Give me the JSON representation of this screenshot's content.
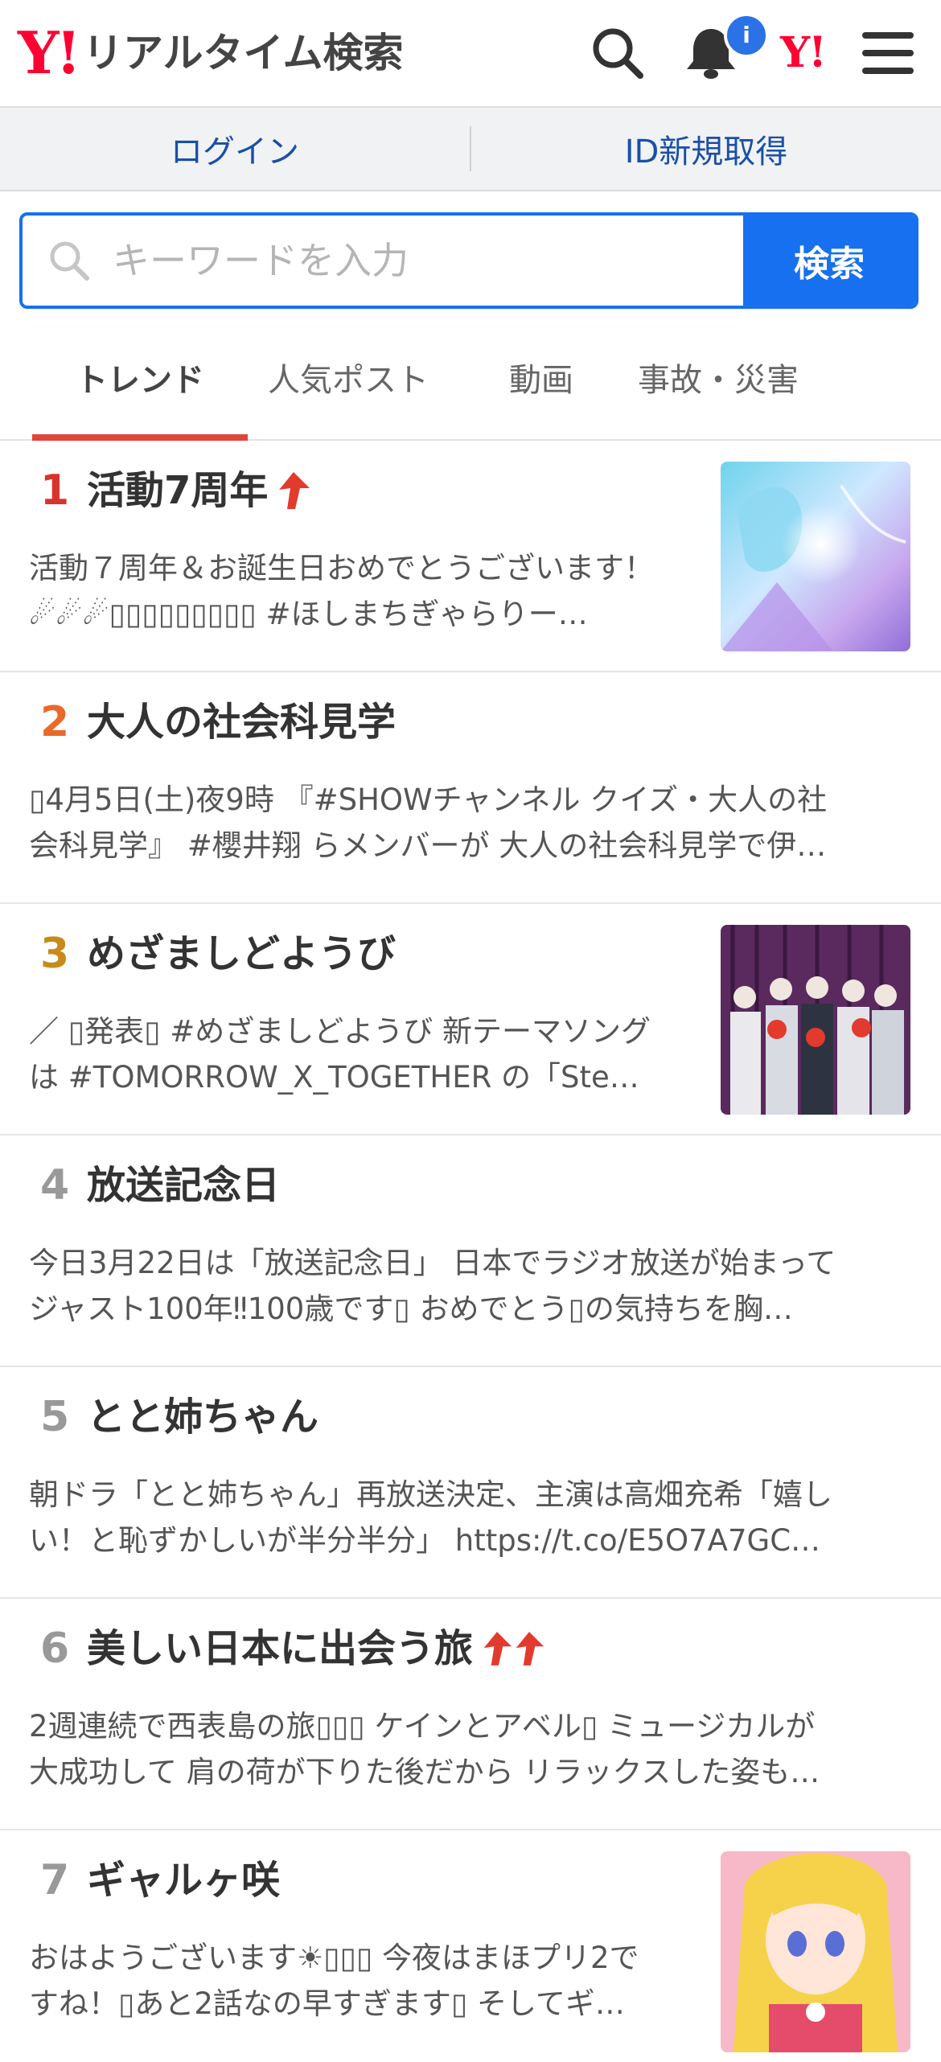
{
  "header": {
    "logo_mark": "Y!",
    "site_name": "リアルタイム検索",
    "notification_badge": "i",
    "yj_icon_text": "Y!"
  },
  "auth": {
    "login": "ログイン",
    "register": "ID新規取得"
  },
  "search": {
    "placeholder": "キーワードを入力",
    "button": "検索"
  },
  "tabs": [
    {
      "label": "トレンド",
      "active": true
    },
    {
      "label": "人気ポスト",
      "active": false
    },
    {
      "label": "動画",
      "active": false
    },
    {
      "label": "事故・災害",
      "active": false
    }
  ],
  "colors": {
    "accent": "#1670f0",
    "rank1": "#d9342b",
    "rank2": "#e8692a",
    "rank3": "#c88a1a",
    "rank_other": "#999999",
    "arrow": "#e23b2e"
  },
  "trends": [
    {
      "rank": "1",
      "title": "活動7周年",
      "arrows": 1,
      "line1": "活動７周年＆お誕生日おめでとうございます！",
      "line2": "☄☄☄▯▯▯▯▯▯▯▯▯ #ほしまちぎゃらりー…",
      "thumbnail": "anime-blue-hair-illustration"
    },
    {
      "rank": "2",
      "title": "大人の社会科見学",
      "arrows": 0,
      "line1": "▯4月5日(土)夜9時 『#SHOWチャンネル クイズ・大人の社",
      "line2": "会科見学』 #櫻井翔 らメンバーが 大人の社会科見学で伊…",
      "thumbnail": ""
    },
    {
      "rank": "3",
      "title": "めざましどようび",
      "arrows": 0,
      "line1": "／ ▯発表▯ #めざましどようび 新テーマソング",
      "line2": "は #TOMORROW_X_TOGETHER の「Ste…",
      "thumbnail": "group-photo-purple-curtain"
    },
    {
      "rank": "4",
      "title": "放送記念日",
      "arrows": 0,
      "line1": "今日3月22日は「放送記念日」 日本でラジオ放送が始まって",
      "line2": "ジャスト100年‼100歳です▯ おめでとう▯の気持ちを胸…",
      "thumbnail": ""
    },
    {
      "rank": "5",
      "title": "とと姉ちゃん",
      "arrows": 0,
      "line1": "朝ドラ「とと姉ちゃん」再放送決定、主演は高畑充希「嬉し",
      "line2": "い！と恥ずかしいが半分半分」 https://t.co/E5O7A7GC…",
      "thumbnail": ""
    },
    {
      "rank": "6",
      "title": "美しい日本に出会う旅",
      "arrows": 2,
      "line1": "2週連続で西表島の旅▯▯▯ ケインとアベル▯ ミュージカルが",
      "line2": "大成功して 肩の荷が下りた後だから リラックスした姿も…",
      "thumbnail": ""
    },
    {
      "rank": "7",
      "title": "ギャルヶ咲",
      "arrows": 0,
      "line1": "おはようございます☀▯▯▯ 今夜はまほプリ2で",
      "line2": "すね！▯あと2話なの早すぎます▯ そしてギ…",
      "thumbnail": "anime-blonde-girl-illustration"
    }
  ]
}
